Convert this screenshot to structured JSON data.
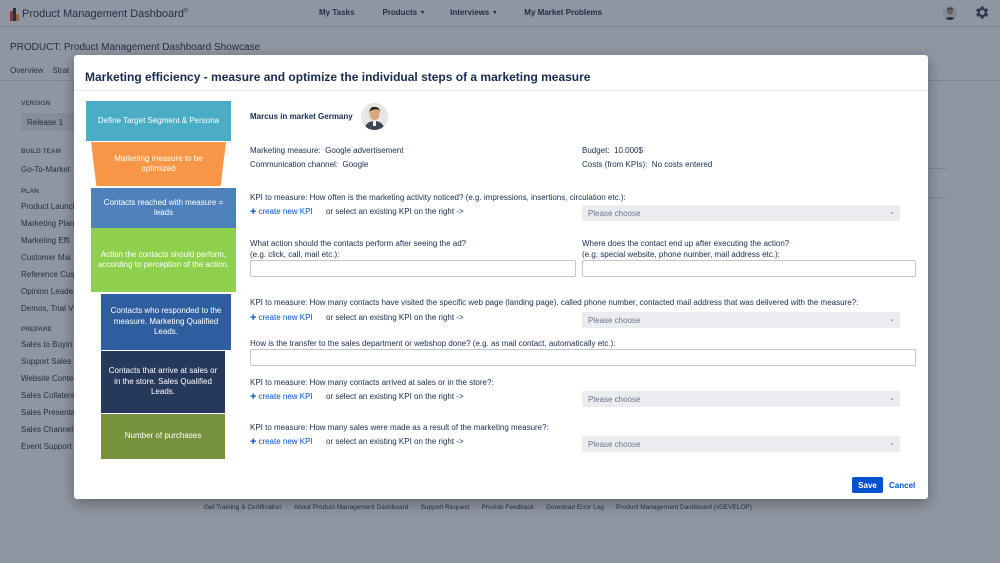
{
  "app": {
    "logo_text": "Product Management Dashboard",
    "logo_reg": "®",
    "nav": [
      {
        "label": "My Tasks",
        "has_dropdown": false
      },
      {
        "label": "Products",
        "has_dropdown": true
      },
      {
        "label": "Interviews",
        "has_dropdown": true
      },
      {
        "label": "My Market Problems",
        "has_dropdown": false
      }
    ],
    "product_heading": "PRODUCT: Product Management Dashboard Showcase",
    "subtabs": [
      "Overview",
      "Strat"
    ],
    "sidebar": {
      "version_label": "VERSION",
      "release": "Release 1",
      "build_team_label": "BUILD TEAM",
      "build_team_items": [
        "Go-To-Market"
      ],
      "plan_label": "PLAN",
      "plan_items": [
        "Product Launch",
        "Marketing Plan",
        "Marketing Effi",
        "Customer Mai",
        "Reference Cus",
        "Opinion Leade",
        "Demos, Trial V"
      ],
      "prepare_label": "PREPARE",
      "prepare_items": [
        "Sales to Buyin",
        "Support Sales",
        "Website Conte",
        "Sales Collatera",
        "Sales Presenta",
        "Sales Channel",
        "Event Support"
      ]
    },
    "footer": [
      "Get Training & Certification",
      "About Product Management Dashboard",
      "Support Request",
      "Provide Feedback",
      "Download Error Log",
      "Product Management Dashboard (vDEVELOP)"
    ],
    "footer_sep": "·"
  },
  "modal": {
    "title": "Marketing efficiency - measure and optimize the individual steps of a marketing measure",
    "funnel": [
      {
        "text": "Define Target Segment & Persona",
        "color": "#4bacc6"
      },
      {
        "text": "Marketing measure to be optimized",
        "color": "#f79646"
      },
      {
        "text": "Contacts reached with measure = leads",
        "color": "#4f81bd"
      },
      {
        "text": "Action the contacts should perform, according to perception of the action.",
        "color": "#8fd14f"
      },
      {
        "text": "Contacts who responded to the measure. Marketing Qualified Leads.",
        "color": "#2e5e9e"
      },
      {
        "text": "Contacts that arrive at sales or in the store. Sales Qualified Leads.",
        "color": "#26395a"
      },
      {
        "text": "Number of purchases",
        "color": "#76923c"
      }
    ],
    "persona_name": "Marcus in market Germany",
    "marketing_measure_label": "Marketing measure:",
    "marketing_measure_value": "Google advertisement",
    "channel_label": "Communication channel:",
    "channel_value": "Google",
    "budget_label": "Budget:",
    "budget_value": "10.000$",
    "costs_label": "Costs (from KPIs):",
    "costs_value": "No costs entered",
    "kpi1_label": "KPI to measure: How often is the marketing activity noticed? (e.g. impressions, insertions, circulation etc.):",
    "create_kpi": "create new KPI",
    "or_select": "or select an existing KPI on the right ->",
    "select_placeholder": "Please choose",
    "action_label_1": "What action should the contacts perform after seeing the ad?",
    "action_label_2": "(e.g. click, call, mail etc.):",
    "where_label_1": "Where does the contact end up after executing the action?",
    "where_label_2": "(e.g. special website, phone number, mail address etc.):",
    "kpi2_label": "KPI to measure: How many contacts have visited the specific web page (landing page), called phone number, contacted mail address that was delivered with the measure?:",
    "transfer_label": "How is the transfer to the sales department or webshop done? (e.g. as mail contact, automatically etc.):",
    "kpi3_label": "KPI to measure: How many contacts arrived at sales or in the store?:",
    "kpi4_label": "KPI to measure: How many sales were made as a result of the marketing measure?:",
    "save_label": "Save",
    "cancel_label": "Cancel"
  }
}
